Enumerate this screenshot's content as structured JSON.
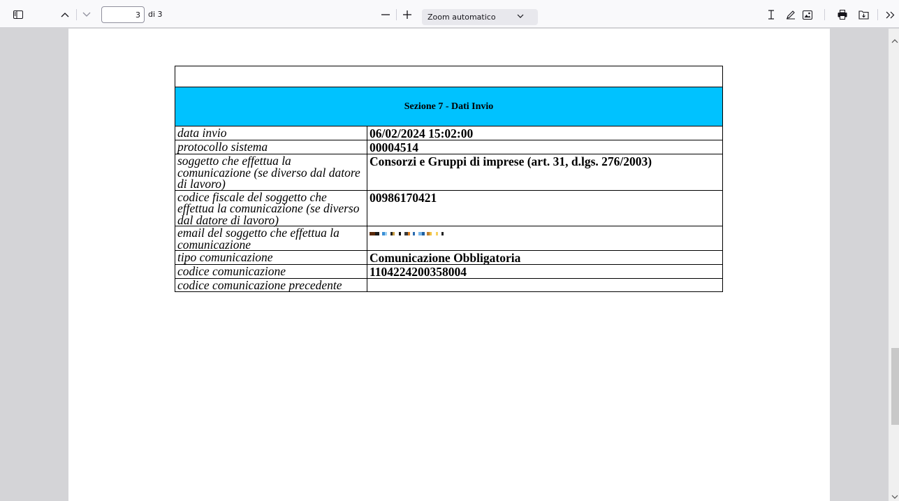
{
  "toolbar": {
    "page_current": "3",
    "page_count": "di 3",
    "zoom_value": "Zoom automatico"
  },
  "document": {
    "section_title": "Sezione 7 - Dati Invio",
    "rows": [
      {
        "label": "data invio",
        "value": "06/02/2024 15:02:00"
      },
      {
        "label": "protocollo sistema",
        "value": "00004514"
      },
      {
        "label": "soggetto che effettua la comunicazione (se diverso dal datore di lavoro)",
        "value": "Consorzi e Gruppi di imprese (art. 31, d.lgs. 276/2003)"
      },
      {
        "label": "codice fiscale del soggetto che effettua la comunicazione (se diverso dal datore di lavoro)",
        "value": "00986170421"
      },
      {
        "label": "email del soggetto che effettua la comunicazione",
        "value": ""
      },
      {
        "label": "tipo comunicazione",
        "value": "Comunicazione Obbligatoria"
      },
      {
        "label": "codice comunicazione",
        "value": "1104224200358004"
      },
      {
        "label": "codice comunicazione precedente",
        "value": ""
      }
    ]
  },
  "colors": {
    "section_header_bg": "#00c2ff",
    "toolbar_bg": "#f9f9fb",
    "viewer_bg": "#d4d4d7"
  }
}
